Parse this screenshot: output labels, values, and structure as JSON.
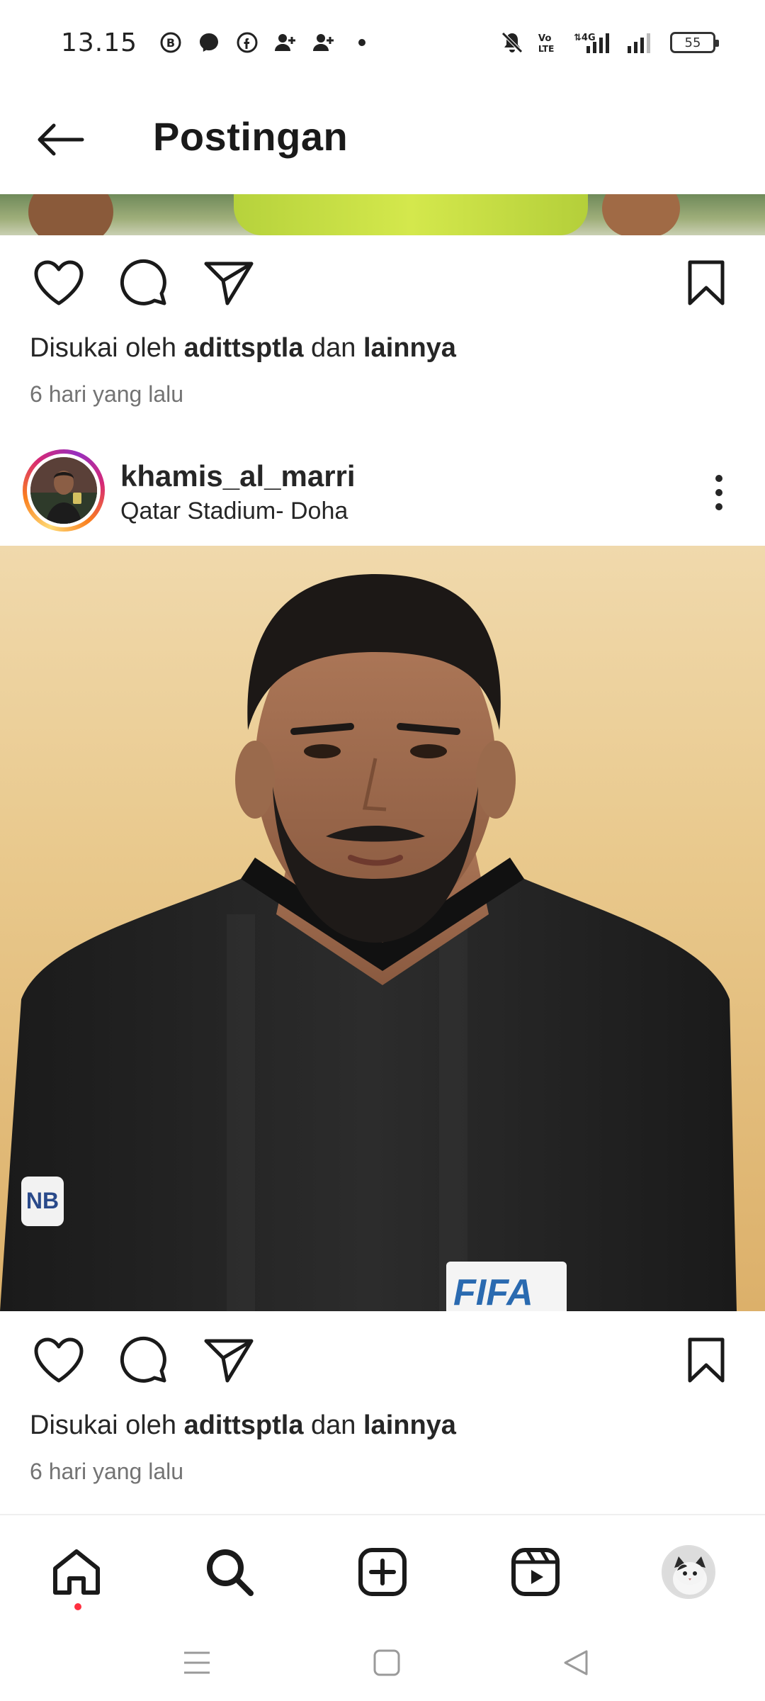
{
  "status_bar": {
    "time": "13.15",
    "battery_level": "55",
    "left_icons": [
      "whatsapp-business-icon",
      "messenger-icon",
      "facebook-icon",
      "person-add-icon",
      "person-add-icon",
      "dot-icon"
    ],
    "right_icons": [
      "mute-icon",
      "volte-icon",
      "4g-signal-icon",
      "signal-icon",
      "battery-icon"
    ],
    "network_label": "4G",
    "volte_label": "Vo LTE"
  },
  "header": {
    "title": "Postingan"
  },
  "posts": [
    {
      "likes_prefix": "Disukai oleh",
      "liked_by": "adittsptla",
      "likes_middle": "dan",
      "likes_others": "lainnya",
      "time_ago": "6 hari yang lalu"
    },
    {
      "username": "khamis_al_marri",
      "location": "Qatar Stadium- Doha",
      "image_text": "FIFA",
      "likes_prefix": "Disukai oleh",
      "liked_by": "adittsptla",
      "likes_middle": "dan",
      "likes_others": "lainnya",
      "time_ago": "6 hari yang lalu"
    }
  ],
  "bottom_nav": {
    "items": [
      "home-icon",
      "search-icon",
      "create-post-icon",
      "reels-icon",
      "profile-avatar"
    ],
    "active": "home",
    "notification_dot_color": "#ff3040"
  },
  "system_nav": [
    "recents-icon",
    "home-square-icon",
    "back-triangle-icon"
  ],
  "colors": {
    "text_primary": "#262626",
    "text_secondary": "#737373",
    "story_ring": [
      "#feda75",
      "#fa7e1e",
      "#d62976",
      "#962fbf"
    ]
  }
}
